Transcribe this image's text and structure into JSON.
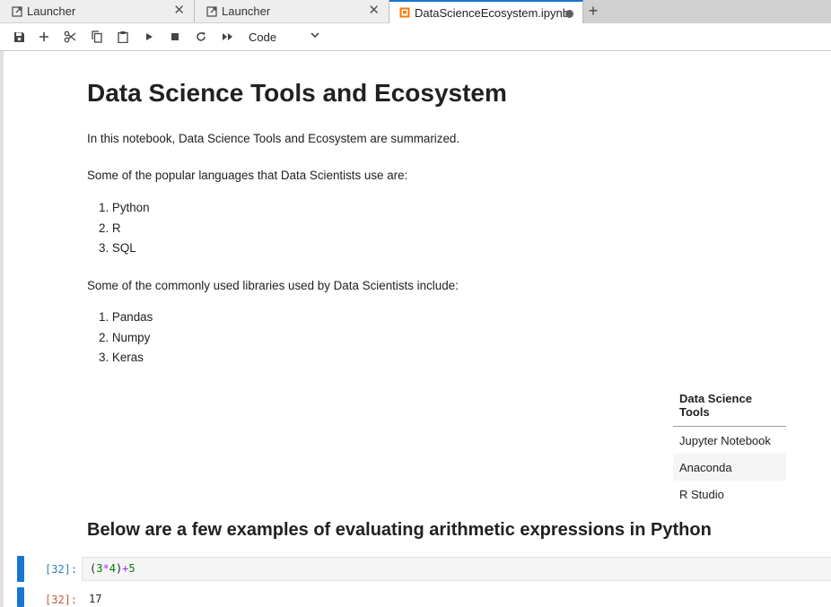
{
  "tabs": [
    {
      "label": "Launcher",
      "icon": "launcher-icon"
    },
    {
      "label": "Launcher",
      "icon": "launcher-icon"
    },
    {
      "label": "DataScienceEcosystem.ipynb",
      "icon": "notebook-icon",
      "active": true,
      "unsaved": true
    }
  ],
  "toolbar": {
    "buttons": [
      "save-icon",
      "add-cell-icon",
      "cut-icon",
      "copy-icon",
      "paste-icon",
      "run-icon",
      "stop-icon",
      "restart-icon",
      "run-all-icon"
    ],
    "cell_type": "Code"
  },
  "notebook": {
    "title": "Data Science Tools and Ecosystem",
    "intro": "In this notebook, Data Science Tools and Ecosystem are summarized.",
    "languages_intro": "Some of the popular languages that Data Scientists use are:",
    "languages": [
      "1. Python",
      "2. R",
      "3. SQL"
    ],
    "libraries_intro": "Some of the commonly used libraries used by Data Scientists include:",
    "libraries": [
      "1. Pandas",
      "2. Numpy",
      "3. Keras"
    ],
    "tools_table": {
      "header": "Data Science Tools",
      "rows": [
        "Jupyter Notebook",
        "Anaconda",
        "R Studio"
      ]
    },
    "arithmetic_heading": "Below are a few examples of evaluating arithmetic expressions in Python",
    "code_cell": {
      "input_prompt": "[32]:",
      "code_parts": [
        "(",
        "3",
        "*",
        "4",
        ")",
        "+",
        "5"
      ],
      "output_prompt": "[32]:",
      "output": "17"
    }
  },
  "colors": {
    "accent": "#1976d2",
    "input_prompt": "#307fc1",
    "output_prompt": "#bf5b3d"
  }
}
